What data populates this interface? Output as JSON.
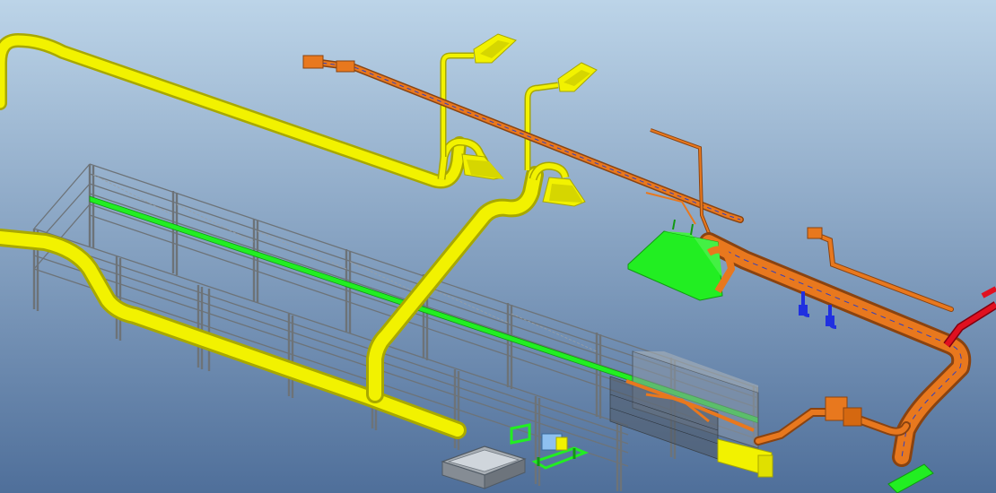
{
  "viewport": {
    "background_top": "#bcd4e8",
    "background_bottom": "#4f6f9a"
  },
  "colors": {
    "yellow_pipe": "#f2f200",
    "yellow_pipe_shade": "#a8a800",
    "orange_duct": "#e8781e",
    "orange_duct_shade": "#8a4310",
    "green_panel": "#22ee22",
    "green_panel_shade": "#119911",
    "frame_gray": "#6d7378",
    "frame_light": "#9aa0a4",
    "red_pipe": "#e01020",
    "blue_part": "#2030e0",
    "tank_gray": "#a8aeb4",
    "light_blue": "#8ec0f0"
  }
}
